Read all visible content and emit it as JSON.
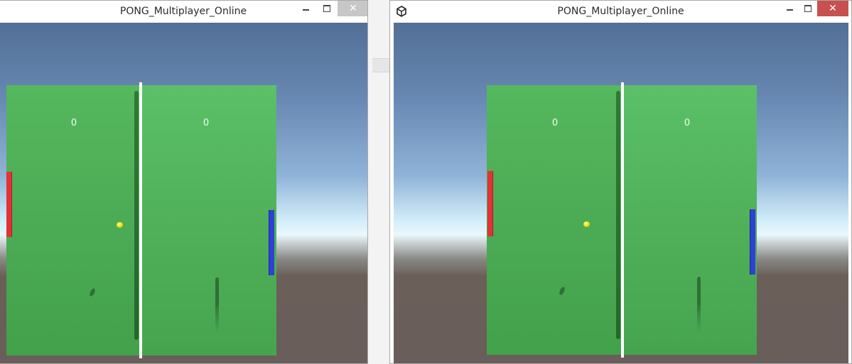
{
  "windows": [
    {
      "title": "PONG_Multiplayer_Online",
      "score_left": "0",
      "score_right": "0"
    },
    {
      "title": "PONG_Multiplayer_Online",
      "score_left": "0",
      "score_right": "0"
    }
  ],
  "controls": {
    "minimize_icon": "minimize-icon",
    "maximize_icon": "maximize-icon",
    "close_icon": "close-icon",
    "close_glyph": "✕"
  },
  "colors": {
    "red_paddle": "#e23238",
    "blue_paddle": "#2f3fd8",
    "court": "#4cab55",
    "ball": "#e8d800",
    "close_active": "#c75050"
  }
}
